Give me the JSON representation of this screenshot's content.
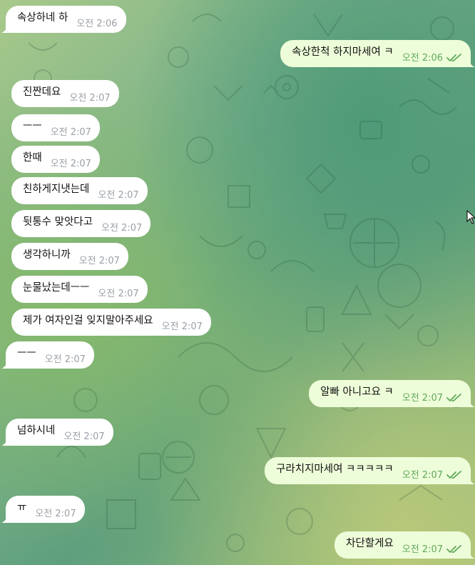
{
  "messages": [
    {
      "dir": "in",
      "text": "속상하네 하",
      "time": "오전 2:06"
    },
    {
      "dir": "out",
      "text": "속상한척 하지마세여 ㅋ",
      "time": "오전 2:06",
      "read": true
    },
    {
      "dir": "in",
      "text": "진짠데요",
      "time": "오전 2:07"
    },
    {
      "dir": "in",
      "text": "ㅡㅡ",
      "time": "오전 2:07"
    },
    {
      "dir": "in",
      "text": "한때",
      "time": "오전 2:07"
    },
    {
      "dir": "in",
      "text": "친하게지냇는데",
      "time": "오전 2:07"
    },
    {
      "dir": "in",
      "text": "뒷통수 맞앗다고",
      "time": "오전 2:07"
    },
    {
      "dir": "in",
      "text": "생각하니까",
      "time": "오전 2:07"
    },
    {
      "dir": "in",
      "text": "눈물났는데ㅡㅡ",
      "time": "오전 2:07"
    },
    {
      "dir": "in",
      "text": "제가 여자인걸 잊지말아주세요",
      "time": "오전 2:07"
    },
    {
      "dir": "in",
      "text": "ㅡㅡ",
      "time": "오전 2:07"
    },
    {
      "dir": "out",
      "text": "알빠 아니고요 ㅋ",
      "time": "오전 2:07",
      "read": true
    },
    {
      "dir": "in",
      "text": "넘하시네",
      "time": "오전 2:07"
    },
    {
      "dir": "out",
      "text": "구라치지마세여 ㅋㅋㅋㅋㅋ",
      "time": "오전 2:07",
      "read": true
    },
    {
      "dir": "in",
      "text": "ㅠ",
      "time": "오전 2:07"
    },
    {
      "dir": "out",
      "text": "차단할게요",
      "time": "오전 2:07",
      "read": true
    }
  ],
  "colors": {
    "incoming_bubble": "#ffffff",
    "outgoing_bubble": "#eefdd9",
    "timestamp_in": "#9aa0a6",
    "timestamp_out": "#5ea85a",
    "read_checks": "#5ea85a"
  }
}
